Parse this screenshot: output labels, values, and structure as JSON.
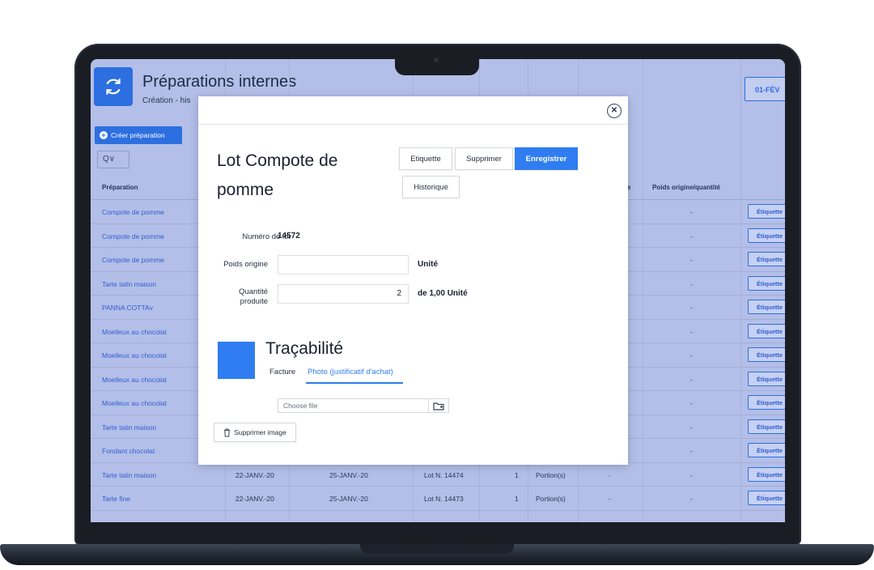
{
  "app": {
    "title": "Préparations internes",
    "subtitle": "Création - his",
    "date_button": "01-FÉV",
    "create_button": "Créer préparation",
    "search_glyph": "Q∨",
    "icon": "refresh-icon"
  },
  "table": {
    "headers": {
      "preparation": "Préparation",
      "e_col": "e",
      "poids": "Poids origine/quantité"
    },
    "label_button": "Étiquette",
    "rows": [
      {
        "prep": "Compote de pomme",
        "d1": "",
        "d2": "",
        "lot": "",
        "qty": "",
        "unit": "",
        "dash1": "",
        "dash2": "-"
      },
      {
        "prep": "Compote de pomme",
        "d1": "",
        "d2": "",
        "lot": "",
        "qty": "",
        "unit": "",
        "dash1": "",
        "dash2": "-"
      },
      {
        "prep": "Compote de pomme",
        "d1": "",
        "d2": "",
        "lot": "",
        "qty": "",
        "unit": "",
        "dash1": "",
        "dash2": "-"
      },
      {
        "prep": "Tarte tatin maison",
        "d1": "",
        "d2": "",
        "lot": "",
        "qty": "",
        "unit": "",
        "dash1": "",
        "dash2": "-"
      },
      {
        "prep": "PANNA COTTAv",
        "d1": "",
        "d2": "",
        "lot": "",
        "qty": "",
        "unit": "",
        "dash1": "",
        "dash2": "-"
      },
      {
        "prep": "Moelleux au chocolat",
        "d1": "",
        "d2": "",
        "lot": "",
        "qty": "",
        "unit": "",
        "dash1": "",
        "dash2": "-"
      },
      {
        "prep": "Moelleux au chocolat",
        "d1": "",
        "d2": "",
        "lot": "",
        "qty": "",
        "unit": "",
        "dash1": "",
        "dash2": "-"
      },
      {
        "prep": "Moelleux au chocolat",
        "d1": "",
        "d2": "",
        "lot": "",
        "qty": "",
        "unit": "",
        "dash1": "",
        "dash2": "-"
      },
      {
        "prep": "Moelleux au chocolat",
        "d1": "",
        "d2": "",
        "lot": "",
        "qty": "",
        "unit": "",
        "dash1": "",
        "dash2": "-"
      },
      {
        "prep": "Tarte tatin maison",
        "d1": "",
        "d2": "",
        "lot": "",
        "qty": "",
        "unit": "",
        "dash1": "",
        "dash2": "-"
      },
      {
        "prep": "Fondant chocolat",
        "d1": "",
        "d2": "",
        "lot": "",
        "qty": "",
        "unit": "",
        "dash1": "",
        "dash2": "-"
      },
      {
        "prep": "Tarte tatin maison",
        "d1": "22-JANV.-20",
        "d2": "25-JANV.-20",
        "lot": "Lot N. 14474",
        "qty": "1",
        "unit": "Portion(s)",
        "dash1": "-",
        "dash2": "-"
      },
      {
        "prep": "Tarte fine",
        "d1": "22-JANV.-20",
        "d2": "25-JANV.-20",
        "lot": "Lot N. 14473",
        "qty": "1",
        "unit": "Portion(s)",
        "dash1": "-",
        "dash2": "-"
      }
    ]
  },
  "modal": {
    "title": "Lot Compote de pomme",
    "buttons": {
      "etiquette": "Etiquette",
      "supprimer": "Supprimer",
      "enregistrer": "Enregistrer",
      "historique": "Historique"
    },
    "lot_number_label": "Numéro de lot",
    "lot_number_value": "14572",
    "poids_label": "Poids origine",
    "poids_value": "",
    "poids_unit": "Unité",
    "quantite_label_1": "Quantité",
    "quantite_label_2": "produite",
    "quantite_value": "2",
    "quantite_unit": "de 1,00 Unité",
    "tracabilite_title": "Traçabilité",
    "tabs": [
      "Facture",
      "Photo (justificatif d'achat)"
    ],
    "file_placeholder": "Choose file",
    "delete_image": "Supprimer image"
  },
  "colors": {
    "primary": "#2f7df0",
    "overlay": "#b3bfe8"
  }
}
